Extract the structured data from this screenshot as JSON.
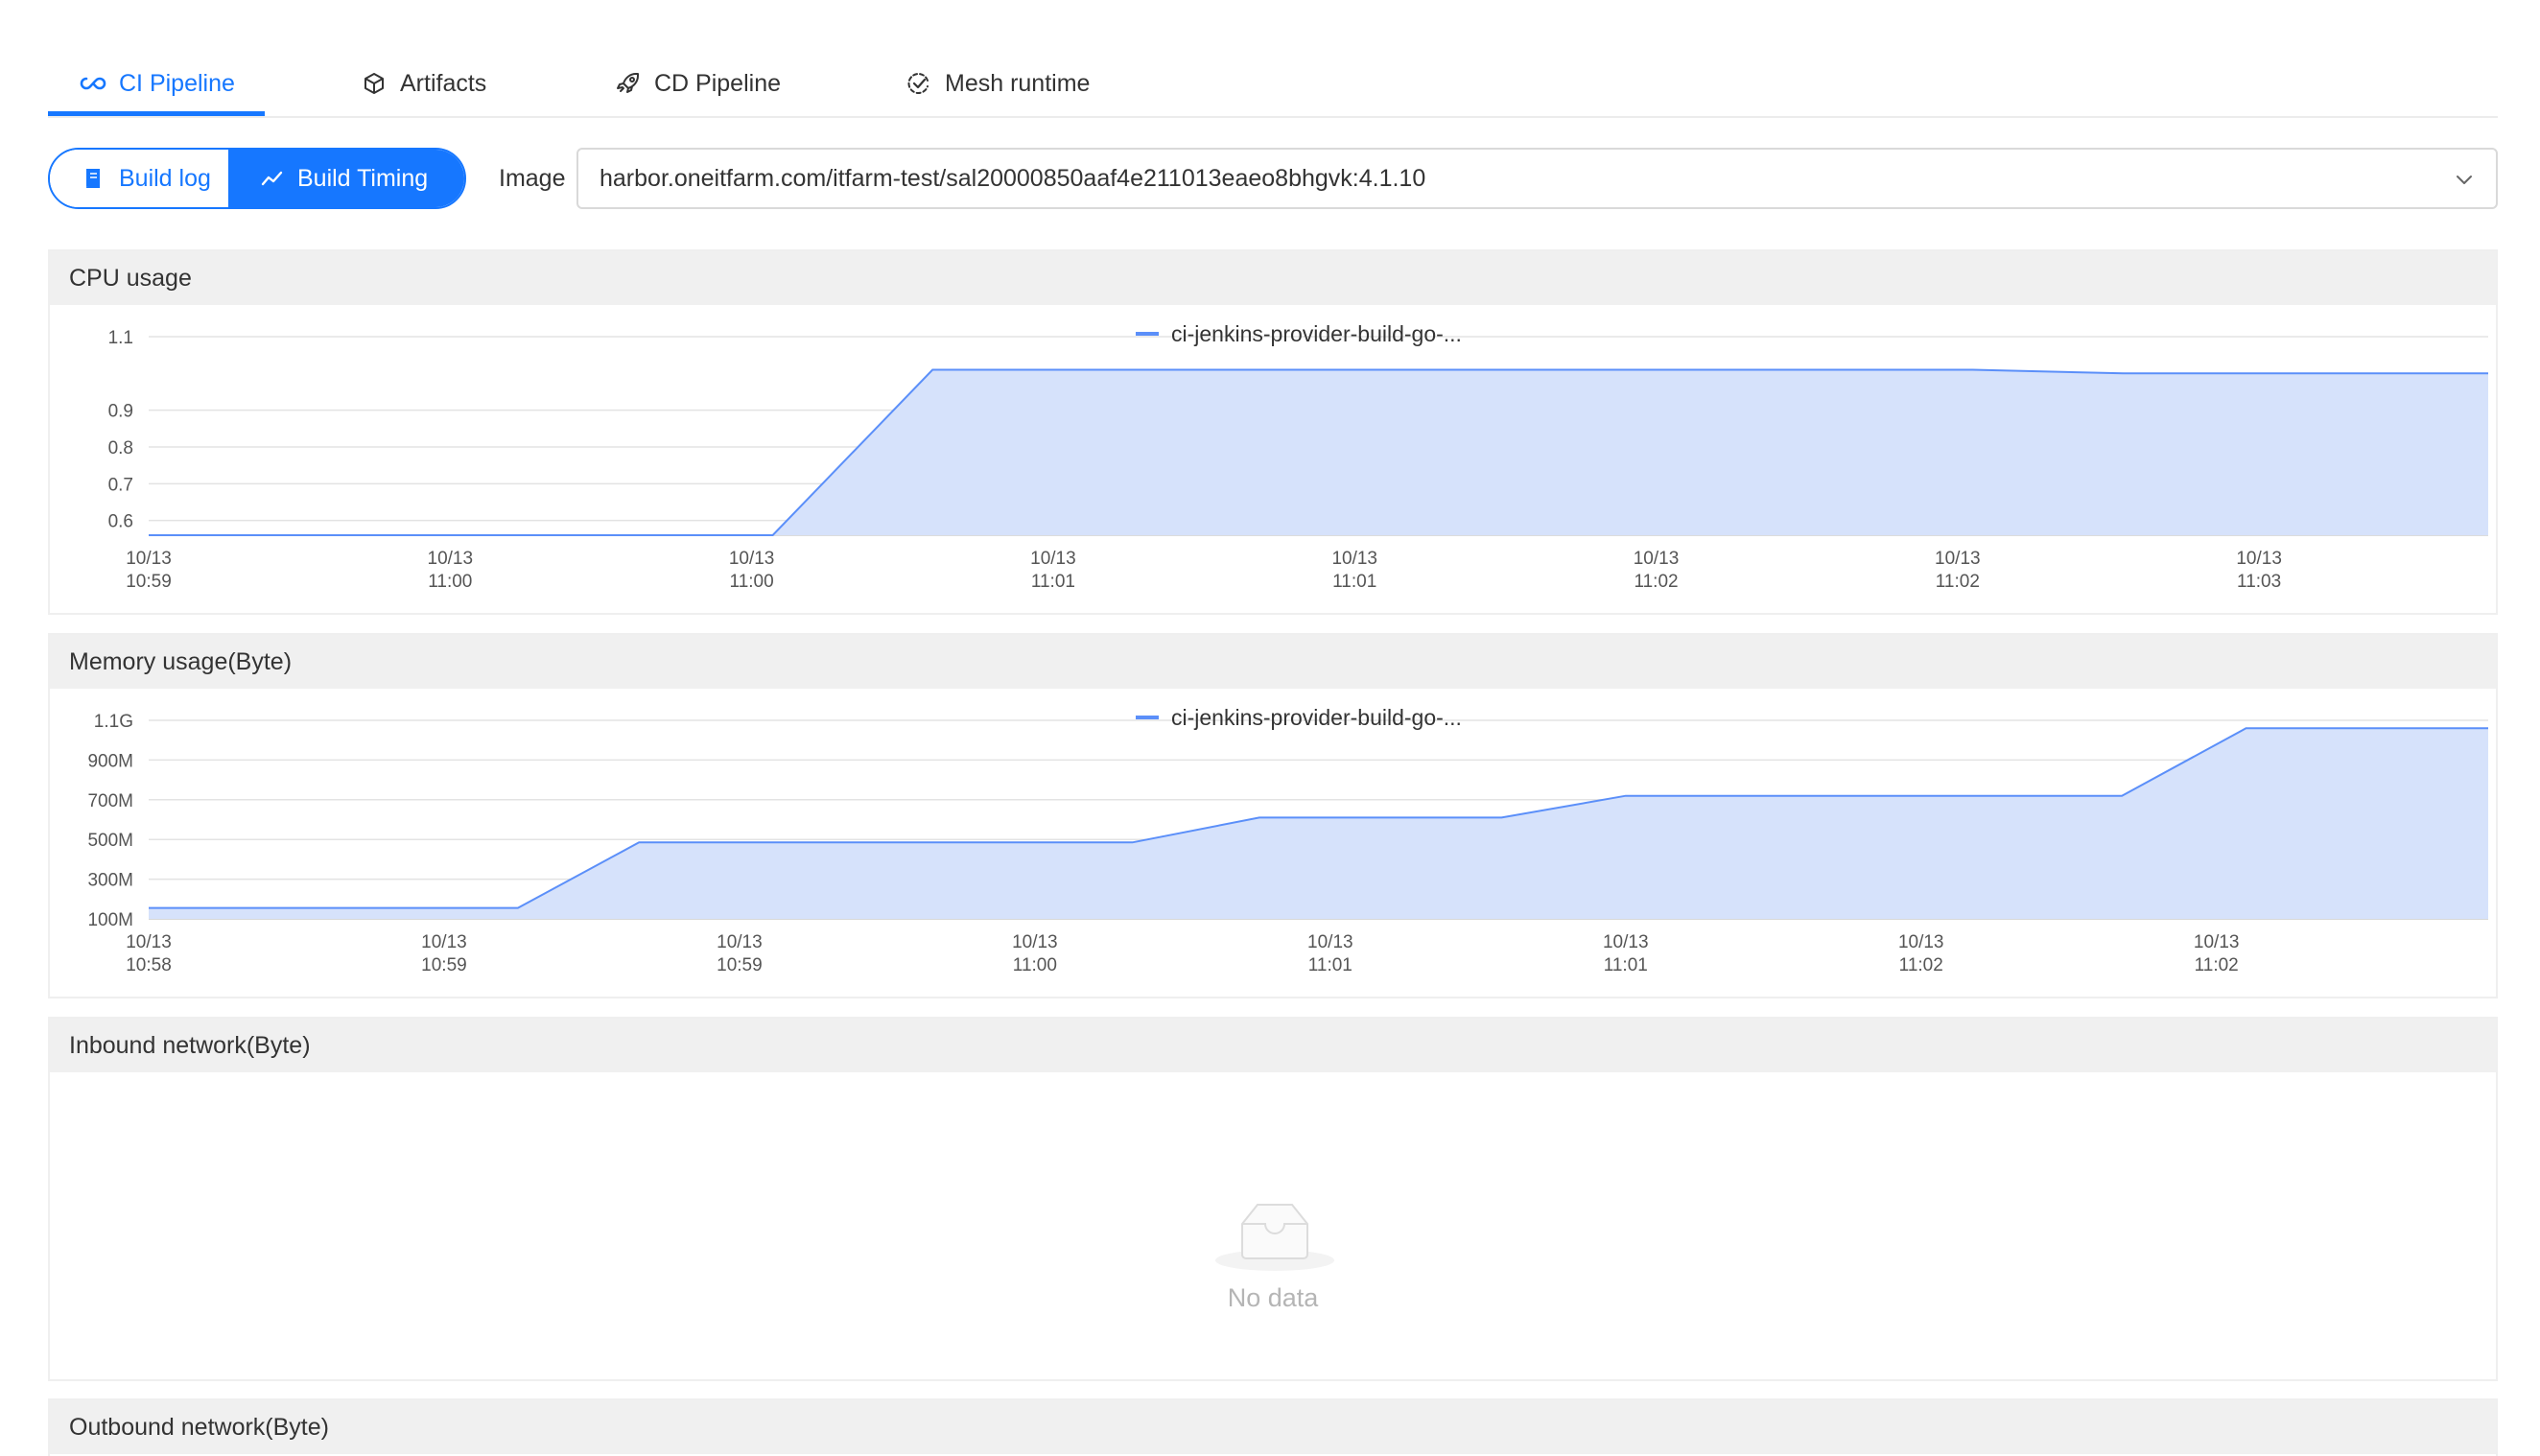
{
  "tabs": [
    {
      "label": "CI Pipeline",
      "icon": "infinity-icon",
      "active": true
    },
    {
      "label": "Artifacts",
      "icon": "cube-icon",
      "active": false
    },
    {
      "label": "CD Pipeline",
      "icon": "rocket-icon",
      "active": false
    },
    {
      "label": "Mesh runtime",
      "icon": "check-cycle-icon",
      "active": false
    }
  ],
  "toolbar": {
    "build_log_label": "Build log",
    "build_timing_label": "Build Timing",
    "image_label": "Image",
    "image_value": "harbor.oneitfarm.com/itfarm-test/sal20000850aaf4e211013eaeo8bhgvk:4.1.10"
  },
  "colors": {
    "accent": "#1677ff",
    "series_line": "#5b8ff9",
    "series_fill": "#d6e2fb"
  },
  "panels": {
    "cpu_title": "CPU usage",
    "memory_title": "Memory usage(Byte)",
    "inbound_title": "Inbound network(Byte)",
    "inbound_empty_text": "No data",
    "outbound_title": "Outbound network(Byte)"
  },
  "chart_data": [
    {
      "type": "area",
      "title": "CPU usage",
      "legend": "ci-jenkins-provider-build-go-...",
      "legend_position": "top-center",
      "grid": true,
      "y_ticks": [
        {
          "label": "1.1",
          "value": 1.1
        },
        {
          "label": "0.9",
          "value": 0.9
        },
        {
          "label": "0.8",
          "value": 0.8
        },
        {
          "label": "0.7",
          "value": 0.7
        },
        {
          "label": "0.6",
          "value": 0.6
        }
      ],
      "ylim": [
        0.56,
        1.1
      ],
      "x_ticks": [
        {
          "label": [
            "10/13",
            "10:59"
          ],
          "value": 0
        },
        {
          "label": [
            "10/13",
            "11:00"
          ],
          "value": 1
        },
        {
          "label": [
            "10/13",
            "11:00"
          ],
          "value": 2
        },
        {
          "label": [
            "10/13",
            "11:01"
          ],
          "value": 3
        },
        {
          "label": [
            "10/13",
            "11:01"
          ],
          "value": 4
        },
        {
          "label": [
            "10/13",
            "11:02"
          ],
          "value": 5
        },
        {
          "label": [
            "10/13",
            "11:02"
          ],
          "value": 6
        },
        {
          "label": [
            "10/13",
            "11:03"
          ],
          "value": 7
        }
      ],
      "xlim": [
        0,
        7.76
      ],
      "series": [
        {
          "points": [
            [
              0,
              0.56
            ],
            [
              2.07,
              0.56
            ],
            [
              2.6,
              1.01
            ],
            [
              6.05,
              1.01
            ],
            [
              6.55,
              1.0
            ],
            [
              7.76,
              1.0
            ]
          ]
        }
      ]
    },
    {
      "type": "area",
      "title": "Memory usage(Byte)",
      "legend": "ci-jenkins-provider-build-go-...",
      "legend_position": "top-center",
      "grid": true,
      "y_ticks": [
        {
          "label": "1.1G",
          "value": 1100
        },
        {
          "label": "900M",
          "value": 900
        },
        {
          "label": "700M",
          "value": 700
        },
        {
          "label": "500M",
          "value": 500
        },
        {
          "label": "300M",
          "value": 300
        },
        {
          "label": "100M",
          "value": 100
        }
      ],
      "ylim": [
        100,
        1100
      ],
      "x_ticks": [
        {
          "label": [
            "10/13",
            "10:58"
          ],
          "value": 0
        },
        {
          "label": [
            "10/13",
            "10:59"
          ],
          "value": 1
        },
        {
          "label": [
            "10/13",
            "10:59"
          ],
          "value": 2
        },
        {
          "label": [
            "10/13",
            "11:00"
          ],
          "value": 3
        },
        {
          "label": [
            "10/13",
            "11:01"
          ],
          "value": 4
        },
        {
          "label": [
            "10/13",
            "11:01"
          ],
          "value": 5
        },
        {
          "label": [
            "10/13",
            "11:02"
          ],
          "value": 6
        },
        {
          "label": [
            "10/13",
            "11:02"
          ],
          "value": 7
        }
      ],
      "xlim": [
        0,
        7.92
      ],
      "series": [
        {
          "points": [
            [
              0,
              155
            ],
            [
              1.25,
              155
            ],
            [
              1.66,
              485
            ],
            [
              3.33,
              485
            ],
            [
              3.76,
              610
            ],
            [
              4.58,
              610
            ],
            [
              5.0,
              720
            ],
            [
              6.68,
              720
            ],
            [
              7.1,
              1060
            ],
            [
              7.92,
              1060
            ]
          ]
        }
      ]
    }
  ]
}
